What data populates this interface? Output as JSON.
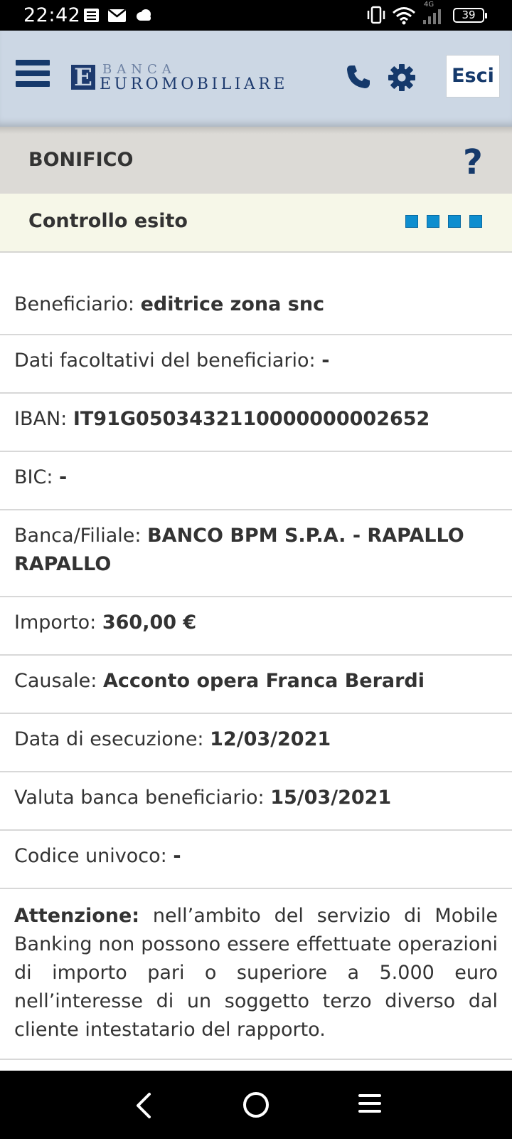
{
  "status_bar": {
    "time": "22:42",
    "network_label": "4G",
    "battery": "39",
    "icons": [
      "notes-icon",
      "mail-icon",
      "cloud-icon",
      "vibrate-icon",
      "wifi-icon",
      "signal-icon",
      "battery-icon"
    ]
  },
  "header": {
    "logo_letter": "E",
    "logo_line1": "BANCA",
    "logo_line2": "EUROMOBILIARE",
    "exit_label": "Esci",
    "icons": [
      "menu-icon",
      "phone-icon",
      "gear-icon"
    ],
    "brand_color": "#15396b",
    "background_color": "#ccd7e4"
  },
  "section": {
    "title": "BONIFICO",
    "help_label": "?"
  },
  "step": {
    "title": "Controllo esito",
    "total_steps": 4,
    "completed_steps": 4,
    "step_color": "#0e8ecf"
  },
  "details": [
    {
      "label": "Beneficiario:",
      "value": "editrice zona snc"
    },
    {
      "label": "Dati facoltativi del beneficiario:",
      "value": "-"
    },
    {
      "label": "IBAN:",
      "value": "IT91G0503432110000000002652"
    },
    {
      "label": "BIC:",
      "value": "-"
    },
    {
      "label": "Banca/Filiale:",
      "value": "BANCO BPM S.P.A. - RAPALLO RAPALLO"
    },
    {
      "label": "Importo:",
      "value": "360,00 €"
    },
    {
      "label": "Causale:",
      "value": "Acconto opera Franca Berardi"
    },
    {
      "label": "Data di esecuzione:",
      "value": "12/03/2021"
    },
    {
      "label": "Valuta banca beneficiario:",
      "value": "15/03/2021"
    },
    {
      "label": "Codice univoco:",
      "value": "-"
    }
  ],
  "notice": {
    "title": "Attenzione:",
    "text": "nell’ambito del servizio di Mobile Banking non possono essere effettuate operazioni di importo pari o superiore a 5.000 euro nell’interesse di un soggetto terzo diverso dal cliente intestatario del rapporto."
  },
  "nav_bar": {
    "icons": [
      "back-icon",
      "home-icon",
      "recent-apps-icon"
    ]
  }
}
